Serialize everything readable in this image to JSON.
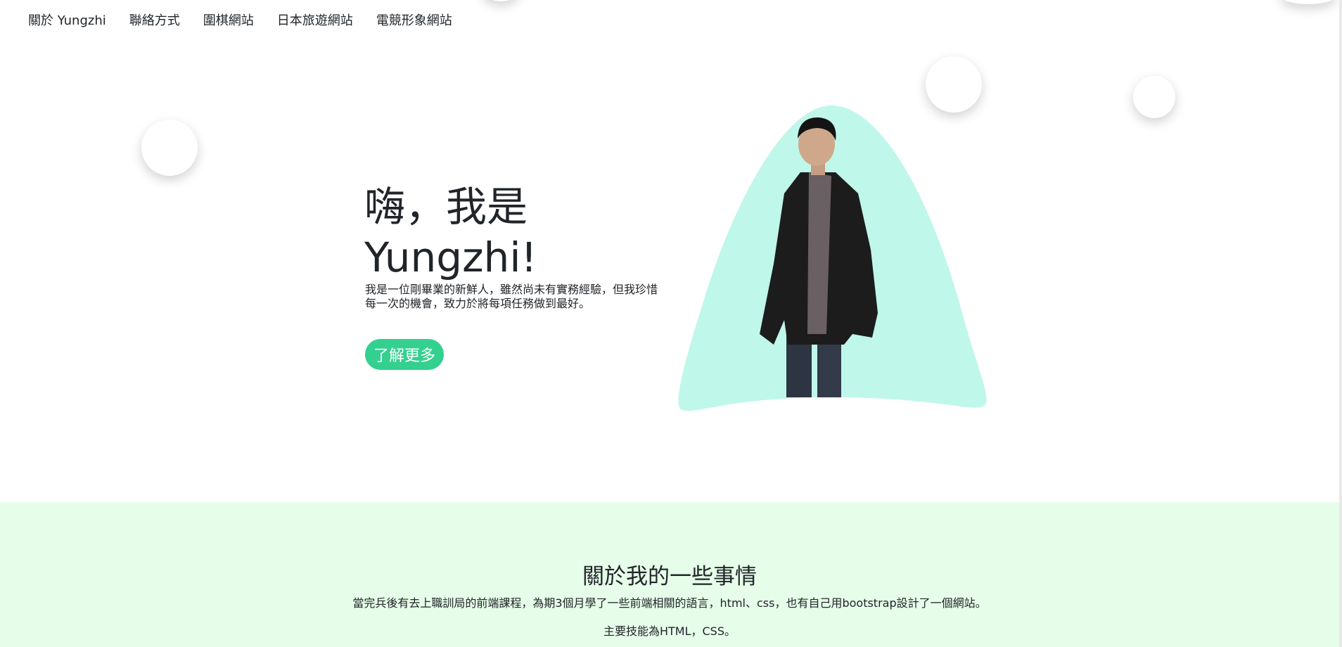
{
  "nav": {
    "items": [
      {
        "label": "關於 Yungzhi"
      },
      {
        "label": "聯絡方式"
      },
      {
        "label": "圍棋網站"
      },
      {
        "label": "日本旅遊網站"
      },
      {
        "label": "電競形象網站"
      }
    ]
  },
  "hero": {
    "title_line1": "嗨，我是",
    "title_line2": "Yungzhi!",
    "description": "我是一位剛畢業的新鮮人，雖然尚未有實務經驗，但我珍惜每一次的機會，致力於將每項任務做到最好。",
    "cta_label": "了解更多"
  },
  "about": {
    "heading": "關於我的一些事情",
    "paragraph": "當完兵後有去上職訓局的前端課程，為期3個月學了一些前端相關的語言，html、css，也有自己用bootstrap設計了一個網站。",
    "skills": "主要技能為HTML，CSS。"
  },
  "colors": {
    "accent": "#34d08f",
    "blob": "#bff7ea",
    "about_bg": "#e6fde9",
    "text": "#212529"
  },
  "icons": {
    "portrait": "person-photo"
  }
}
